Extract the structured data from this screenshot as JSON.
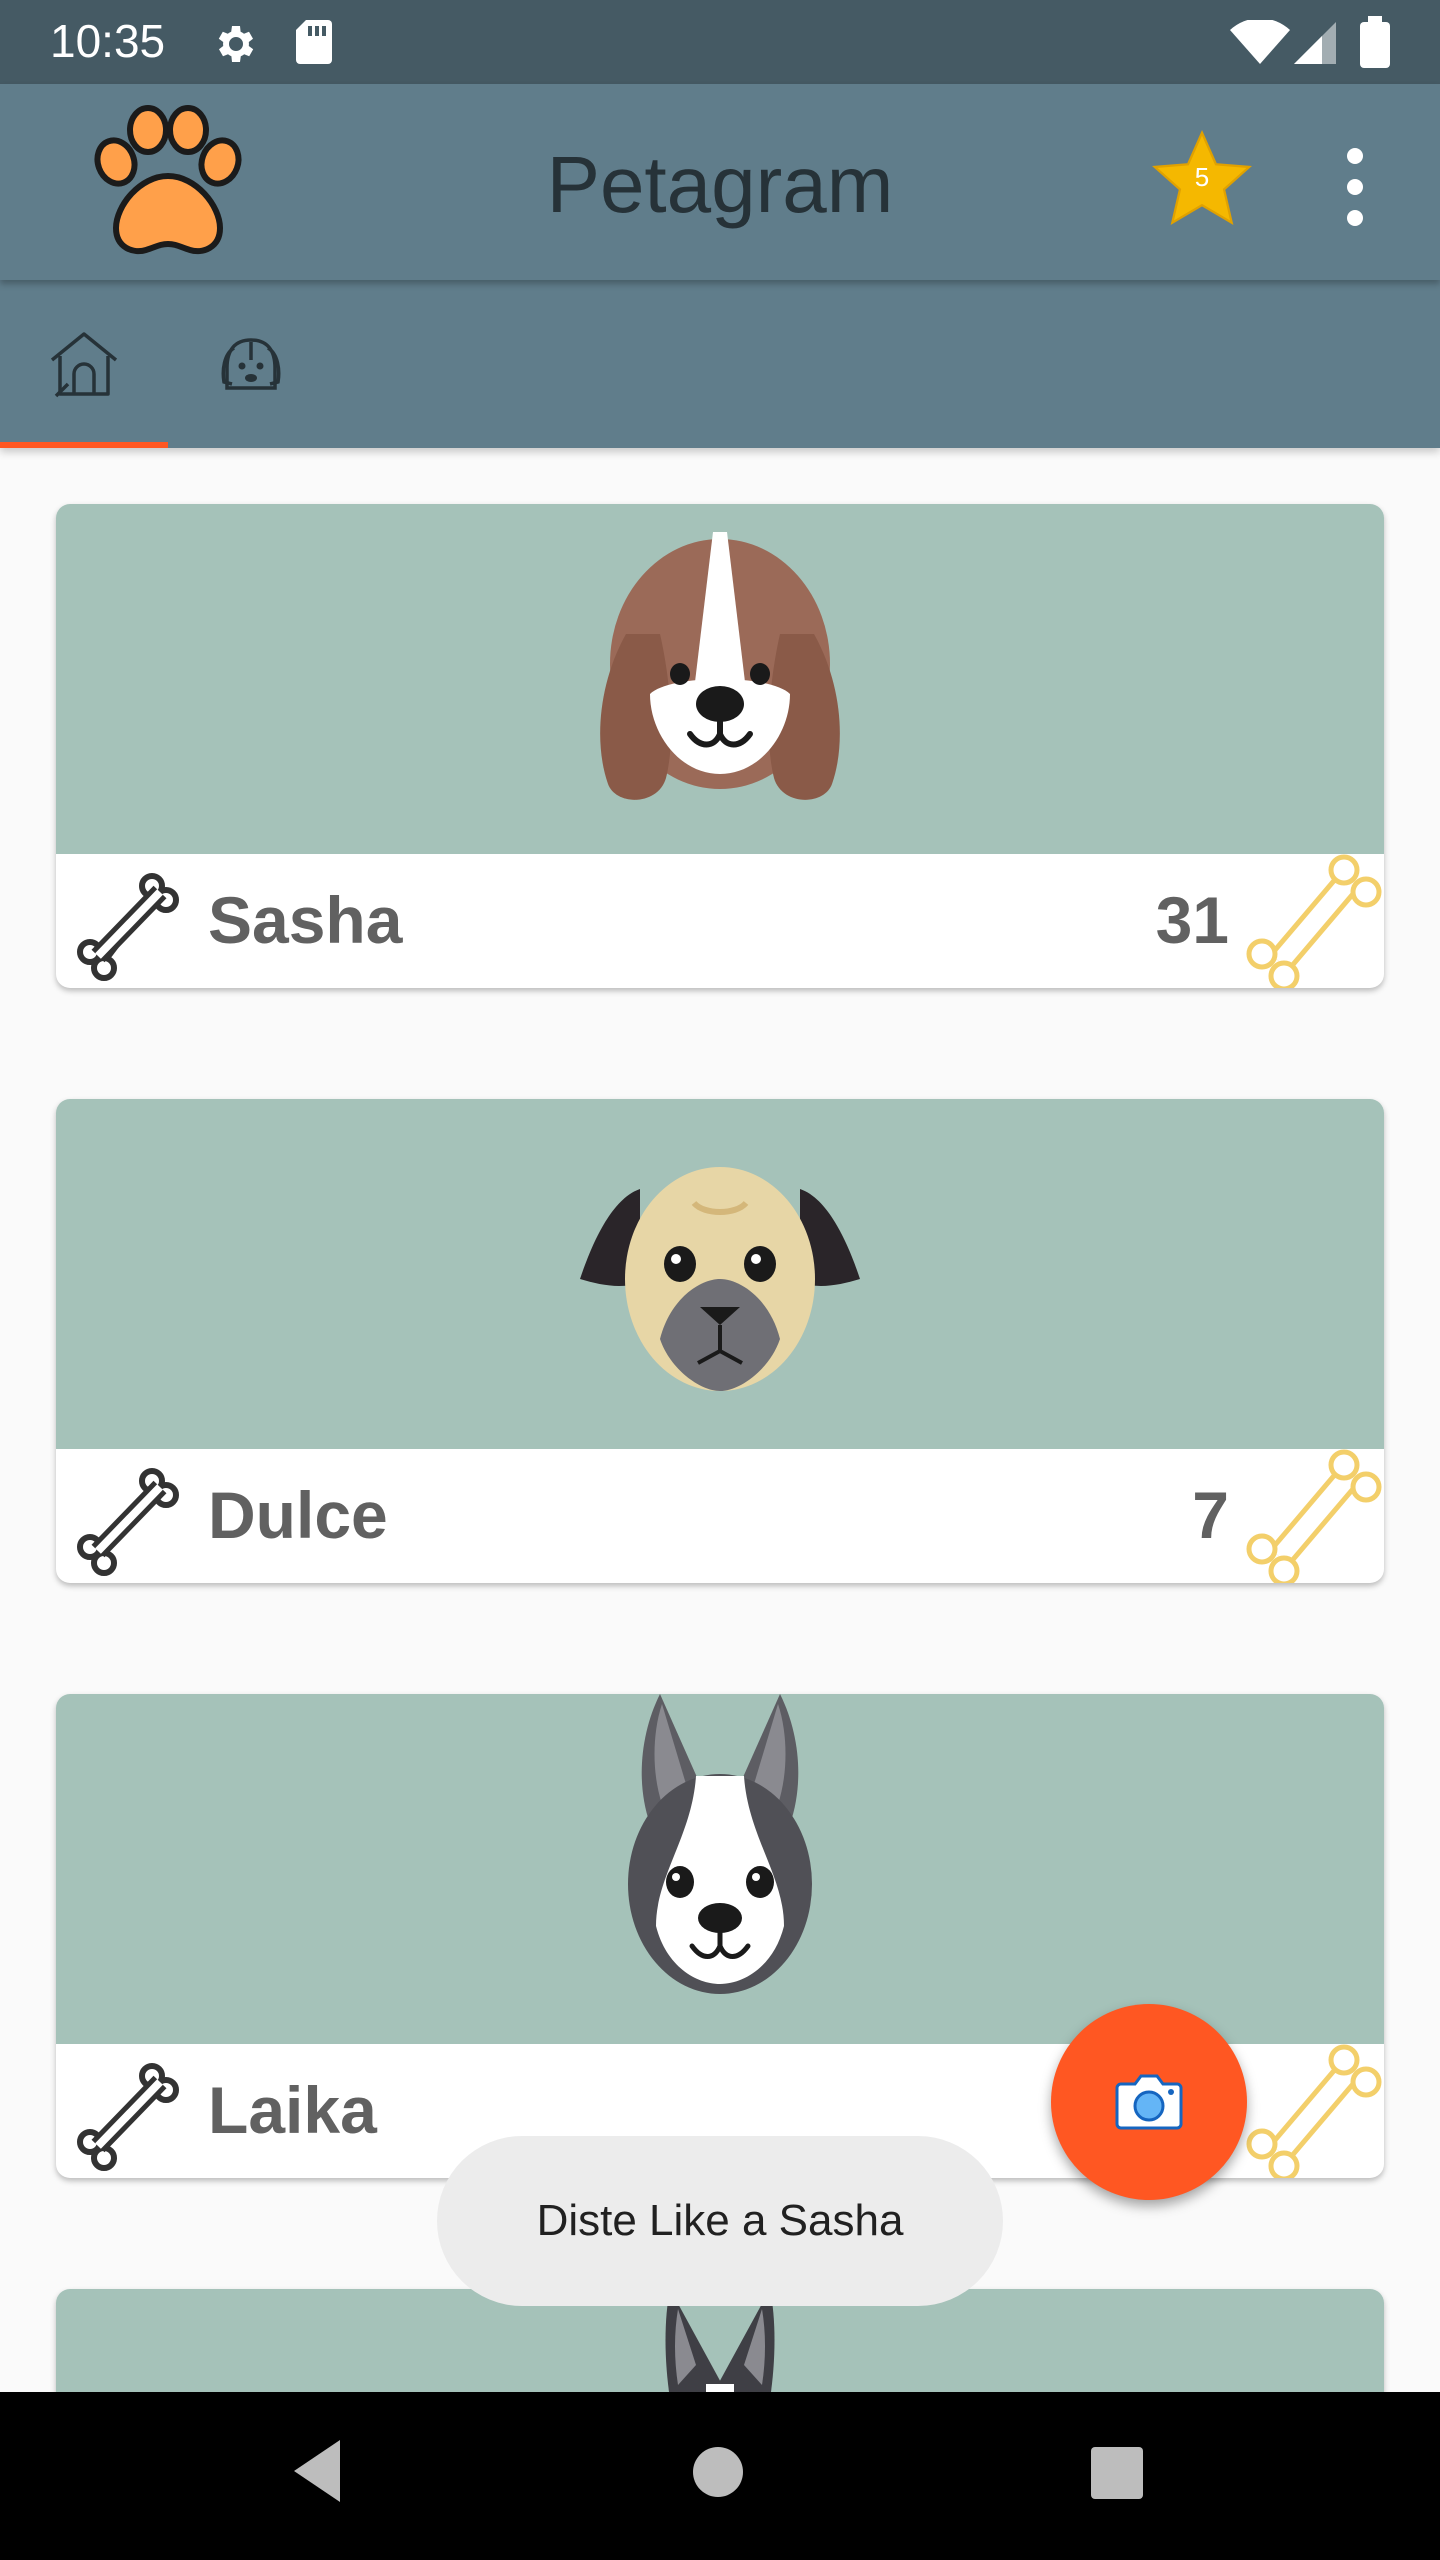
{
  "status_bar": {
    "time": "10:35",
    "icons": [
      "gear-icon",
      "sd-card-icon",
      "wifi-icon",
      "signal-icon",
      "battery-icon"
    ]
  },
  "toolbar": {
    "title": "Petagram",
    "logo_icon": "paw-icon",
    "favorites_count": "5",
    "favorites_icon": "star-icon",
    "menu_icon": "more-vert-icon"
  },
  "tabs": [
    {
      "icon": "doghouse-icon",
      "selected": true
    },
    {
      "icon": "dog-face-icon",
      "selected": false
    }
  ],
  "pets": [
    {
      "name": "Sasha",
      "likes": "31",
      "breed_image": "beagle-face"
    },
    {
      "name": "Dulce",
      "likes": "7",
      "breed_image": "pug-face"
    },
    {
      "name": "Laika",
      "likes": "",
      "breed_image": "boston-terrier-face"
    },
    {
      "name": "",
      "likes": "",
      "breed_image": "dog-ears"
    }
  ],
  "fab": {
    "icon": "camera-icon"
  },
  "toast": {
    "message": "Diste Like a Sasha"
  },
  "colors": {
    "status_bar": "#455a64",
    "toolbar": "#607d8b",
    "accent": "#ff5722",
    "card_photo_bg": "#a5c2b9",
    "like_bone": "#f3cf6a"
  },
  "nav_bar": {
    "icons": [
      "back-icon",
      "home-icon",
      "recents-icon"
    ]
  }
}
